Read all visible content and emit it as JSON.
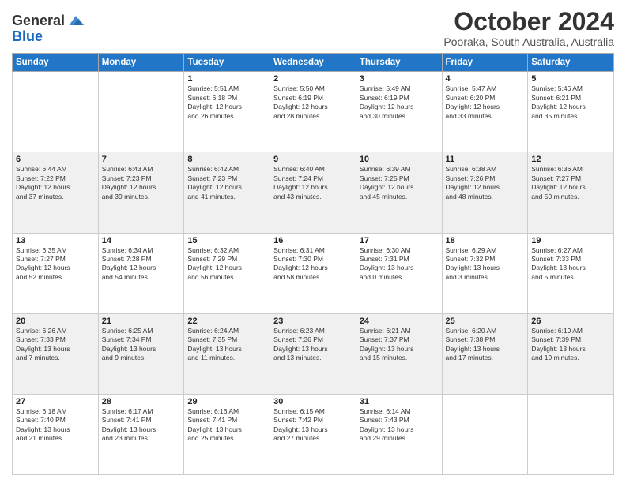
{
  "header": {
    "logo_line1": "General",
    "logo_line2": "Blue",
    "month": "October 2024",
    "location": "Pooraka, South Australia, Australia"
  },
  "days_of_week": [
    "Sunday",
    "Monday",
    "Tuesday",
    "Wednesday",
    "Thursday",
    "Friday",
    "Saturday"
  ],
  "weeks": [
    [
      {
        "day": "",
        "info": ""
      },
      {
        "day": "",
        "info": ""
      },
      {
        "day": "1",
        "info": "Sunrise: 5:51 AM\nSunset: 6:18 PM\nDaylight: 12 hours\nand 26 minutes."
      },
      {
        "day": "2",
        "info": "Sunrise: 5:50 AM\nSunset: 6:19 PM\nDaylight: 12 hours\nand 28 minutes."
      },
      {
        "day": "3",
        "info": "Sunrise: 5:49 AM\nSunset: 6:19 PM\nDaylight: 12 hours\nand 30 minutes."
      },
      {
        "day": "4",
        "info": "Sunrise: 5:47 AM\nSunset: 6:20 PM\nDaylight: 12 hours\nand 33 minutes."
      },
      {
        "day": "5",
        "info": "Sunrise: 5:46 AM\nSunset: 6:21 PM\nDaylight: 12 hours\nand 35 minutes."
      }
    ],
    [
      {
        "day": "6",
        "info": "Sunrise: 6:44 AM\nSunset: 7:22 PM\nDaylight: 12 hours\nand 37 minutes."
      },
      {
        "day": "7",
        "info": "Sunrise: 6:43 AM\nSunset: 7:23 PM\nDaylight: 12 hours\nand 39 minutes."
      },
      {
        "day": "8",
        "info": "Sunrise: 6:42 AM\nSunset: 7:23 PM\nDaylight: 12 hours\nand 41 minutes."
      },
      {
        "day": "9",
        "info": "Sunrise: 6:40 AM\nSunset: 7:24 PM\nDaylight: 12 hours\nand 43 minutes."
      },
      {
        "day": "10",
        "info": "Sunrise: 6:39 AM\nSunset: 7:25 PM\nDaylight: 12 hours\nand 45 minutes."
      },
      {
        "day": "11",
        "info": "Sunrise: 6:38 AM\nSunset: 7:26 PM\nDaylight: 12 hours\nand 48 minutes."
      },
      {
        "day": "12",
        "info": "Sunrise: 6:36 AM\nSunset: 7:27 PM\nDaylight: 12 hours\nand 50 minutes."
      }
    ],
    [
      {
        "day": "13",
        "info": "Sunrise: 6:35 AM\nSunset: 7:27 PM\nDaylight: 12 hours\nand 52 minutes."
      },
      {
        "day": "14",
        "info": "Sunrise: 6:34 AM\nSunset: 7:28 PM\nDaylight: 12 hours\nand 54 minutes."
      },
      {
        "day": "15",
        "info": "Sunrise: 6:32 AM\nSunset: 7:29 PM\nDaylight: 12 hours\nand 56 minutes."
      },
      {
        "day": "16",
        "info": "Sunrise: 6:31 AM\nSunset: 7:30 PM\nDaylight: 12 hours\nand 58 minutes."
      },
      {
        "day": "17",
        "info": "Sunrise: 6:30 AM\nSunset: 7:31 PM\nDaylight: 13 hours\nand 0 minutes."
      },
      {
        "day": "18",
        "info": "Sunrise: 6:29 AM\nSunset: 7:32 PM\nDaylight: 13 hours\nand 3 minutes."
      },
      {
        "day": "19",
        "info": "Sunrise: 6:27 AM\nSunset: 7:33 PM\nDaylight: 13 hours\nand 5 minutes."
      }
    ],
    [
      {
        "day": "20",
        "info": "Sunrise: 6:26 AM\nSunset: 7:33 PM\nDaylight: 13 hours\nand 7 minutes."
      },
      {
        "day": "21",
        "info": "Sunrise: 6:25 AM\nSunset: 7:34 PM\nDaylight: 13 hours\nand 9 minutes."
      },
      {
        "day": "22",
        "info": "Sunrise: 6:24 AM\nSunset: 7:35 PM\nDaylight: 13 hours\nand 11 minutes."
      },
      {
        "day": "23",
        "info": "Sunrise: 6:23 AM\nSunset: 7:36 PM\nDaylight: 13 hours\nand 13 minutes."
      },
      {
        "day": "24",
        "info": "Sunrise: 6:21 AM\nSunset: 7:37 PM\nDaylight: 13 hours\nand 15 minutes."
      },
      {
        "day": "25",
        "info": "Sunrise: 6:20 AM\nSunset: 7:38 PM\nDaylight: 13 hours\nand 17 minutes."
      },
      {
        "day": "26",
        "info": "Sunrise: 6:19 AM\nSunset: 7:39 PM\nDaylight: 13 hours\nand 19 minutes."
      }
    ],
    [
      {
        "day": "27",
        "info": "Sunrise: 6:18 AM\nSunset: 7:40 PM\nDaylight: 13 hours\nand 21 minutes."
      },
      {
        "day": "28",
        "info": "Sunrise: 6:17 AM\nSunset: 7:41 PM\nDaylight: 13 hours\nand 23 minutes."
      },
      {
        "day": "29",
        "info": "Sunrise: 6:16 AM\nSunset: 7:41 PM\nDaylight: 13 hours\nand 25 minutes."
      },
      {
        "day": "30",
        "info": "Sunrise: 6:15 AM\nSunset: 7:42 PM\nDaylight: 13 hours\nand 27 minutes."
      },
      {
        "day": "31",
        "info": "Sunrise: 6:14 AM\nSunset: 7:43 PM\nDaylight: 13 hours\nand 29 minutes."
      },
      {
        "day": "",
        "info": ""
      },
      {
        "day": "",
        "info": ""
      }
    ]
  ]
}
